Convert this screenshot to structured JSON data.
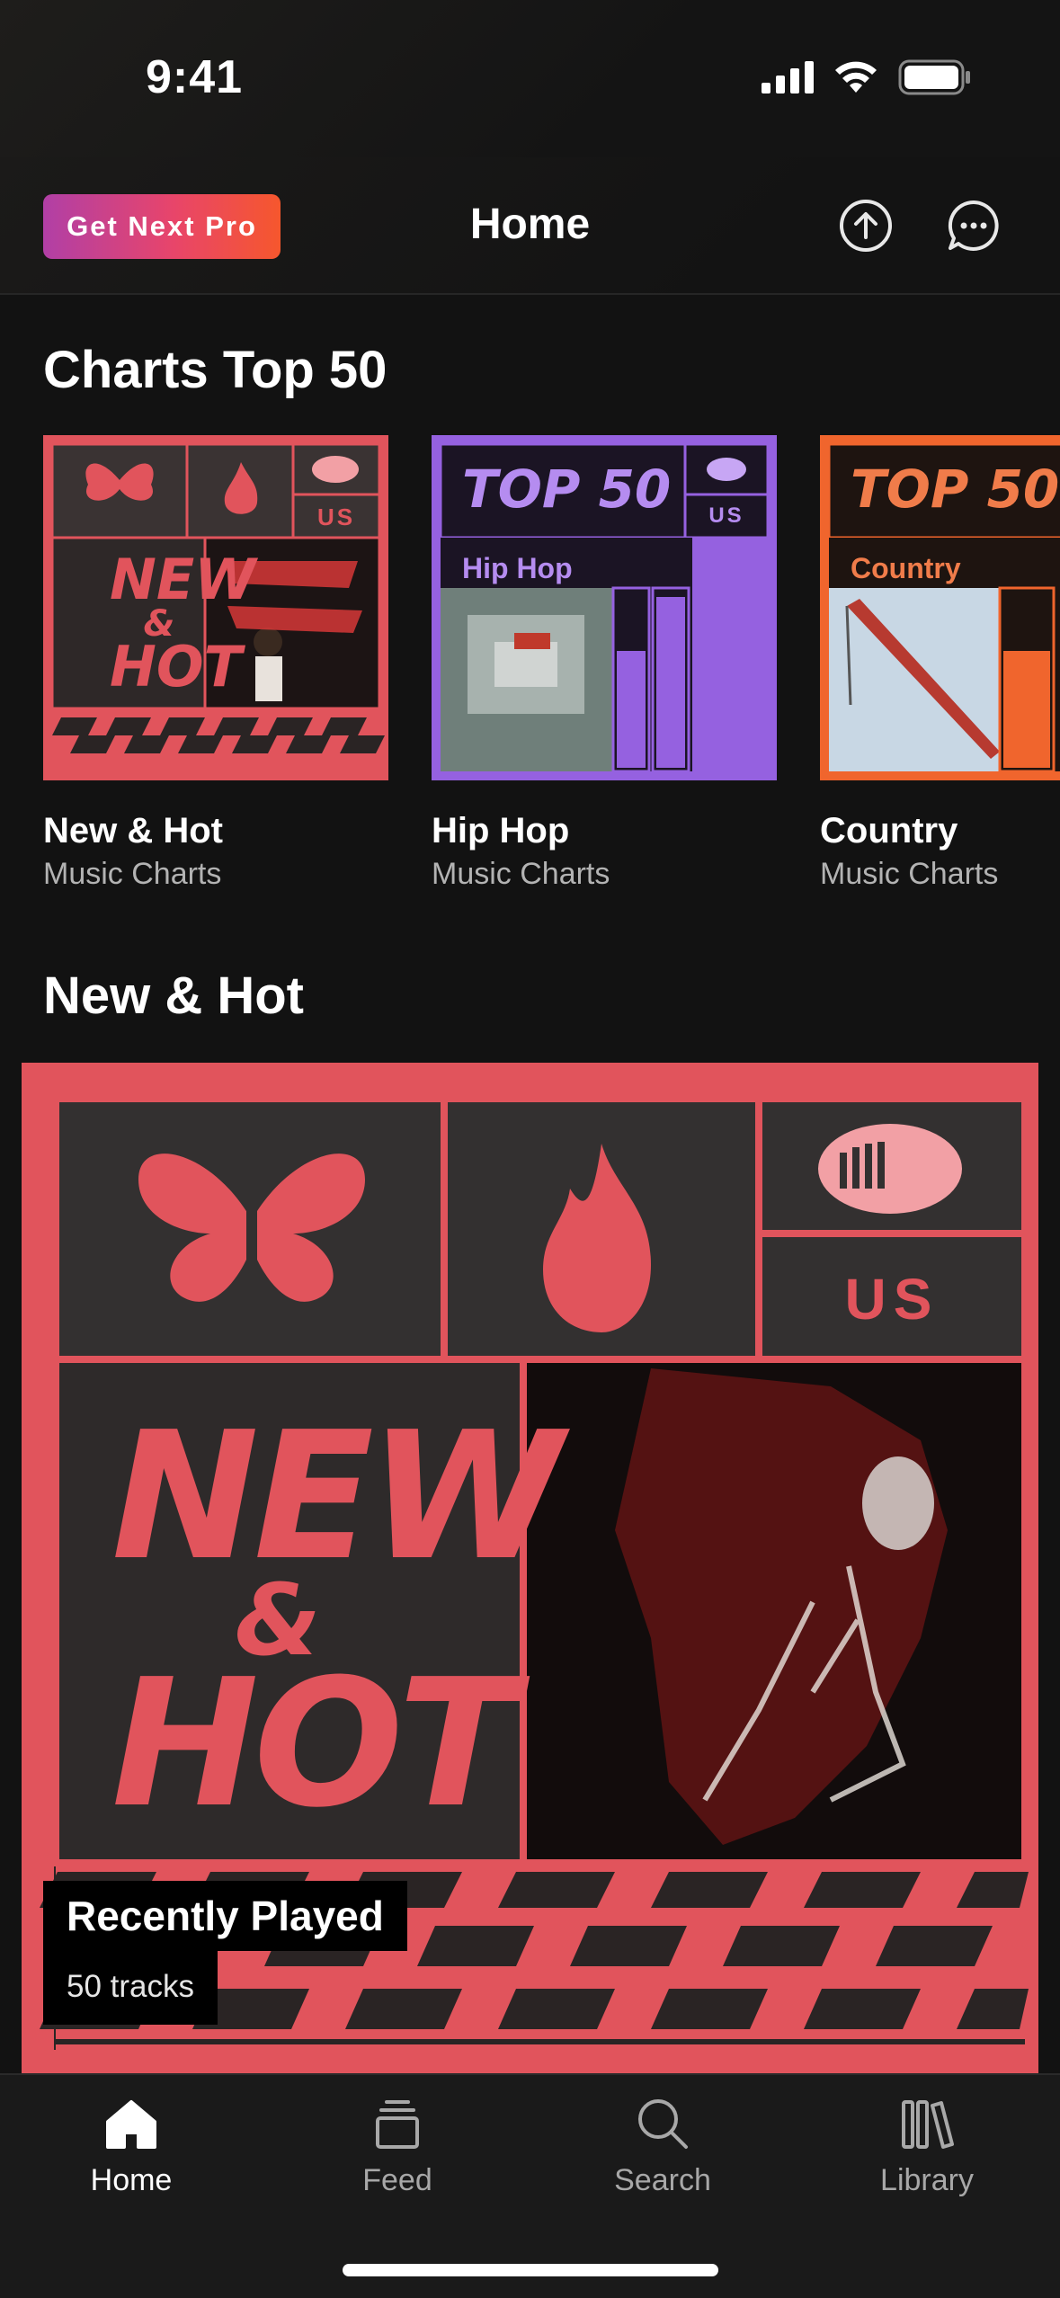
{
  "status": {
    "time": "9:41"
  },
  "nav": {
    "pro_label": "Get Next Pro",
    "title": "Home"
  },
  "charts_section": {
    "title": "Charts Top 50",
    "cards": [
      {
        "name": "New & Hot",
        "subtitle": "Music Charts",
        "cover_lines": [
          "NEW",
          "&",
          "HOT"
        ],
        "badge": "US"
      },
      {
        "name": "Hip Hop",
        "subtitle": "Music Charts",
        "cover_heading": "TOP 50",
        "cover_genre": "Hip Hop",
        "badge": "US"
      },
      {
        "name": "Country",
        "subtitle": "Music Charts",
        "cover_heading": "TOP 50",
        "cover_genre": "Country"
      }
    ]
  },
  "new_hot_section": {
    "title": "New & Hot",
    "card": {
      "cover_lines": [
        "NEW",
        "&",
        "HOT"
      ],
      "badge": "US",
      "title": "Recently Played",
      "subtitle": "50 tracks"
    }
  },
  "tabs": [
    {
      "label": "Home",
      "icon": "home-icon",
      "active": true
    },
    {
      "label": "Feed",
      "icon": "feed-icon",
      "active": false
    },
    {
      "label": "Search",
      "icon": "search-icon",
      "active": false
    },
    {
      "label": "Library",
      "icon": "library-icon",
      "active": false
    }
  ],
  "colors": {
    "background": "#121212",
    "new_hot": "#e1545c",
    "hip_hop": "#9561e0",
    "country": "#f0652d",
    "pro_gradient_start": "#b13fa6",
    "pro_gradient_end": "#f6572d"
  }
}
